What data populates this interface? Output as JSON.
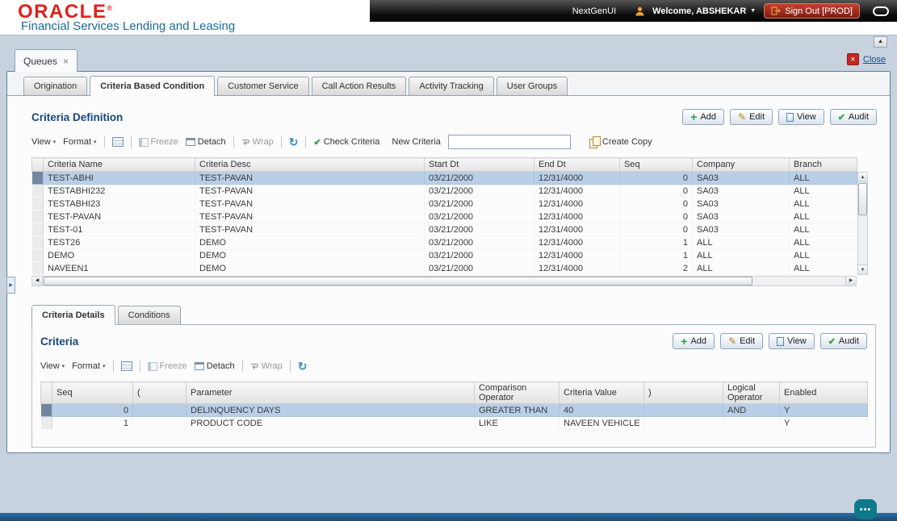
{
  "glyphs": {
    "caret_down_small": "▾",
    "menu_caret": "▼",
    "scroll_up": "▲",
    "scroll_down": "▼",
    "scroll_left": "◀",
    "scroll_right": "▶",
    "check": "✔",
    "pencil": "✎",
    "plus": "+",
    "refresh": "↻",
    "close_x": "✕",
    "tab_close_x": "×",
    "chat_dots": "•••",
    "expander_right": "▶"
  },
  "header": {
    "logo": "ORACLE",
    "registered": "®",
    "subtitle": "Financial Services Lending and Leasing",
    "nextgen_label": "NextGenUI",
    "welcome_label": "Welcome, ABSHEKAR",
    "signout_label": "Sign Out [PROD]"
  },
  "page": {
    "queues_tab_label": "Queues",
    "close_label": "Close"
  },
  "main_tabs": [
    {
      "label": "Origination"
    },
    {
      "label": "Criteria Based Condition"
    },
    {
      "label": "Customer Service"
    },
    {
      "label": "Call Action Results"
    },
    {
      "label": "Activity Tracking"
    },
    {
      "label": "User Groups"
    }
  ],
  "criteria_definition": {
    "title": "Criteria Definition",
    "buttons": {
      "add": "Add",
      "edit": "Edit",
      "view": "View",
      "audit": "Audit"
    },
    "toolbar": {
      "view": "View",
      "format": "Format",
      "freeze": "Freeze",
      "detach": "Detach",
      "wrap": "Wrap",
      "check_criteria": "Check Criteria",
      "new_criteria_label": "New Criteria",
      "new_criteria_value": "",
      "create_copy": "Create Copy"
    },
    "columns": [
      "Criteria Name",
      "Criteria Desc",
      "Start Dt",
      "End Dt",
      "Seq",
      "Company",
      "Branch"
    ],
    "rows": [
      {
        "name": "TEST-ABHI",
        "desc": "TEST-PAVAN",
        "start": "03/21/2000",
        "end": "12/31/4000",
        "seq": "0",
        "company": "SA03",
        "branch": "ALL",
        "selected": true
      },
      {
        "name": "TESTABHI232",
        "desc": "TEST-PAVAN",
        "start": "03/21/2000",
        "end": "12/31/4000",
        "seq": "0",
        "company": "SA03",
        "branch": "ALL"
      },
      {
        "name": "TESTABHI23",
        "desc": "TEST-PAVAN",
        "start": "03/21/2000",
        "end": "12/31/4000",
        "seq": "0",
        "company": "SA03",
        "branch": "ALL"
      },
      {
        "name": "TEST-PAVAN",
        "desc": "TEST-PAVAN",
        "start": "03/21/2000",
        "end": "12/31/4000",
        "seq": "0",
        "company": "SA03",
        "branch": "ALL"
      },
      {
        "name": "TEST-01",
        "desc": "TEST-PAVAN",
        "start": "03/21/2000",
        "end": "12/31/4000",
        "seq": "0",
        "company": "SA03",
        "branch": "ALL"
      },
      {
        "name": "TEST26",
        "desc": "DEMO",
        "start": "03/21/2000",
        "end": "12/31/4000",
        "seq": "1",
        "company": "ALL",
        "branch": "ALL"
      },
      {
        "name": "DEMO",
        "desc": "DEMO",
        "start": "03/21/2000",
        "end": "12/31/4000",
        "seq": "1",
        "company": "ALL",
        "branch": "ALL"
      },
      {
        "name": "NAVEEN1",
        "desc": "DEMO",
        "start": "03/21/2000",
        "end": "12/31/4000",
        "seq": "2",
        "company": "ALL",
        "branch": "ALL"
      }
    ]
  },
  "detail_tabs": [
    {
      "label": "Criteria Details"
    },
    {
      "label": "Conditions"
    }
  ],
  "criteria": {
    "title": "Criteria",
    "buttons": {
      "add": "Add",
      "edit": "Edit",
      "view": "View",
      "audit": "Audit"
    },
    "toolbar": {
      "view": "View",
      "format": "Format",
      "freeze": "Freeze",
      "detach": "Detach",
      "wrap": "Wrap"
    },
    "columns": [
      "Seq",
      "(",
      "Parameter",
      "Comparison Operator",
      "Criteria Value",
      ")",
      "Logical Operator",
      "Enabled"
    ],
    "rows": [
      {
        "seq": "0",
        "open_paren": "",
        "parameter": "DELINQUENCY DAYS",
        "comparison": "GREATER THAN",
        "value": "40",
        "close_paren": "",
        "logical": "AND",
        "enabled": "Y",
        "selected": true
      },
      {
        "seq": "1",
        "open_paren": "",
        "parameter": "PRODUCT CODE",
        "comparison": "LIKE",
        "value": "NAVEEN VEHICLE",
        "close_paren": "",
        "logical": "",
        "enabled": "Y"
      }
    ]
  }
}
